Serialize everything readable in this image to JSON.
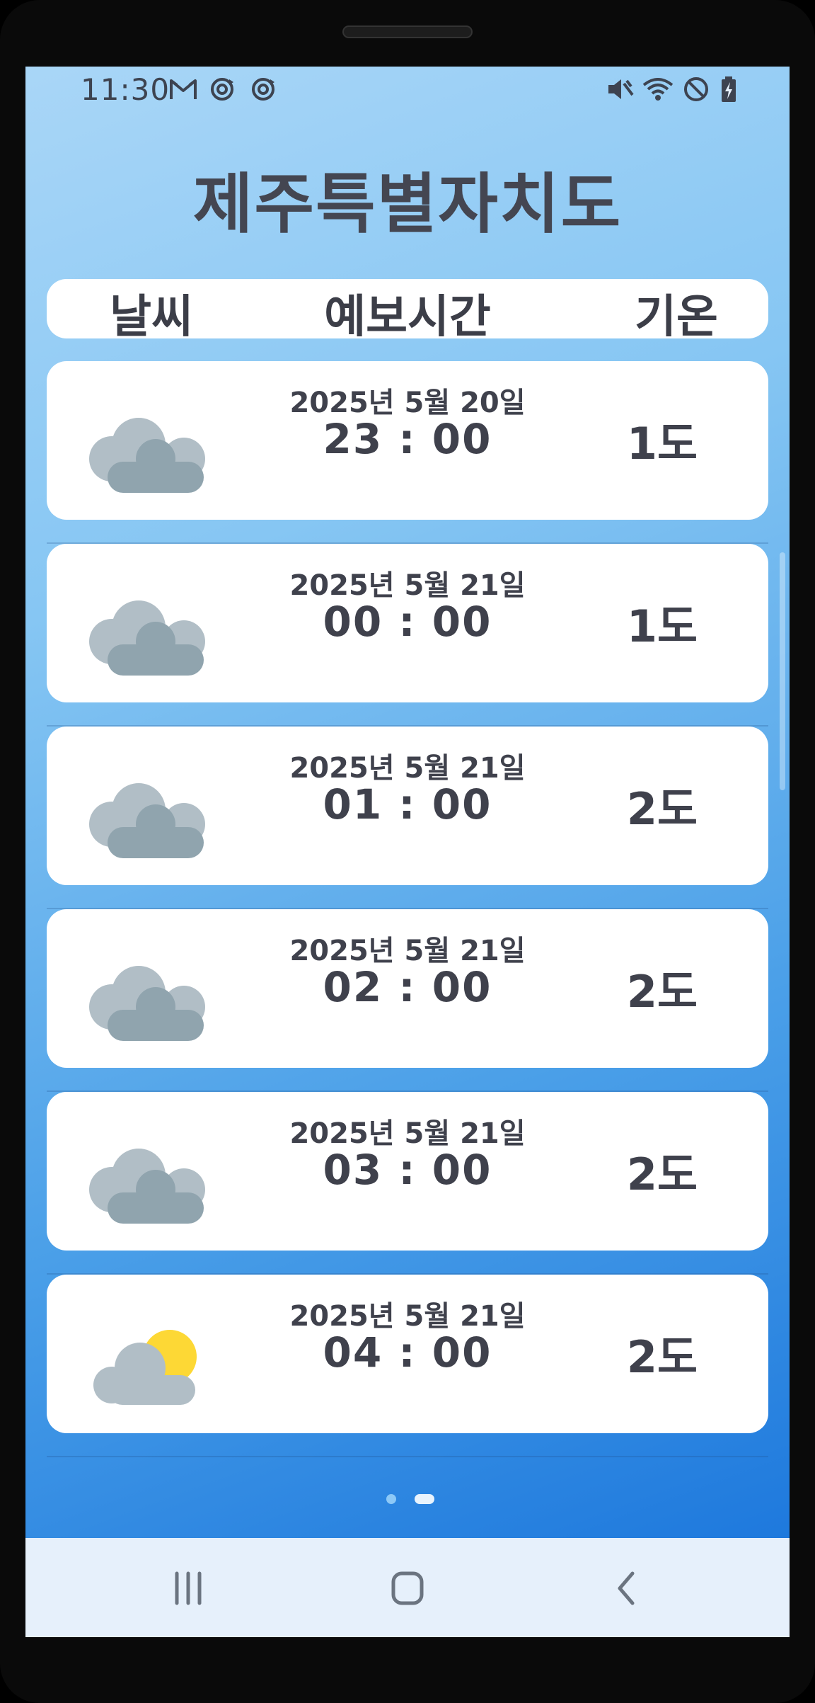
{
  "status_bar": {
    "time": "11:30",
    "left_icons": [
      "gmail-icon",
      "sync-icon",
      "sync-icon"
    ],
    "right_icons": [
      "mute-icon",
      "wifi-icon",
      "do-not-disturb-icon",
      "battery-charging-icon"
    ]
  },
  "title": "제주특별자치도",
  "header": {
    "weather": "날씨",
    "forecast_time": "예보시간",
    "temperature": "기온"
  },
  "rows": [
    {
      "icon": "cloudy-icon",
      "date": "2025년 5월 20일",
      "time": "23 : 00",
      "temp": "1도"
    },
    {
      "icon": "cloudy-icon",
      "date": "2025년 5월 21일",
      "time": "00 : 00",
      "temp": "1도"
    },
    {
      "icon": "cloudy-icon",
      "date": "2025년 5월 21일",
      "time": "01 : 00",
      "temp": "2도"
    },
    {
      "icon": "cloudy-icon",
      "date": "2025년 5월 21일",
      "time": "02 : 00",
      "temp": "2도"
    },
    {
      "icon": "cloudy-icon",
      "date": "2025년 5월 21일",
      "time": "03 : 00",
      "temp": "2도"
    },
    {
      "icon": "partly-cloudy-icon",
      "date": "2025년 5월 21일",
      "time": "04 : 00",
      "temp": "2도"
    }
  ],
  "pager": {
    "pages": 2,
    "current": 2
  },
  "nav": [
    "recent-apps-icon",
    "home-icon",
    "back-icon"
  ],
  "colors": {
    "text": "#3f414c",
    "cloud_back": "#b1bec6",
    "cloud_front": "#90a4ae",
    "sun": "#fdd835",
    "nav_bg": "#e6f0fb"
  }
}
